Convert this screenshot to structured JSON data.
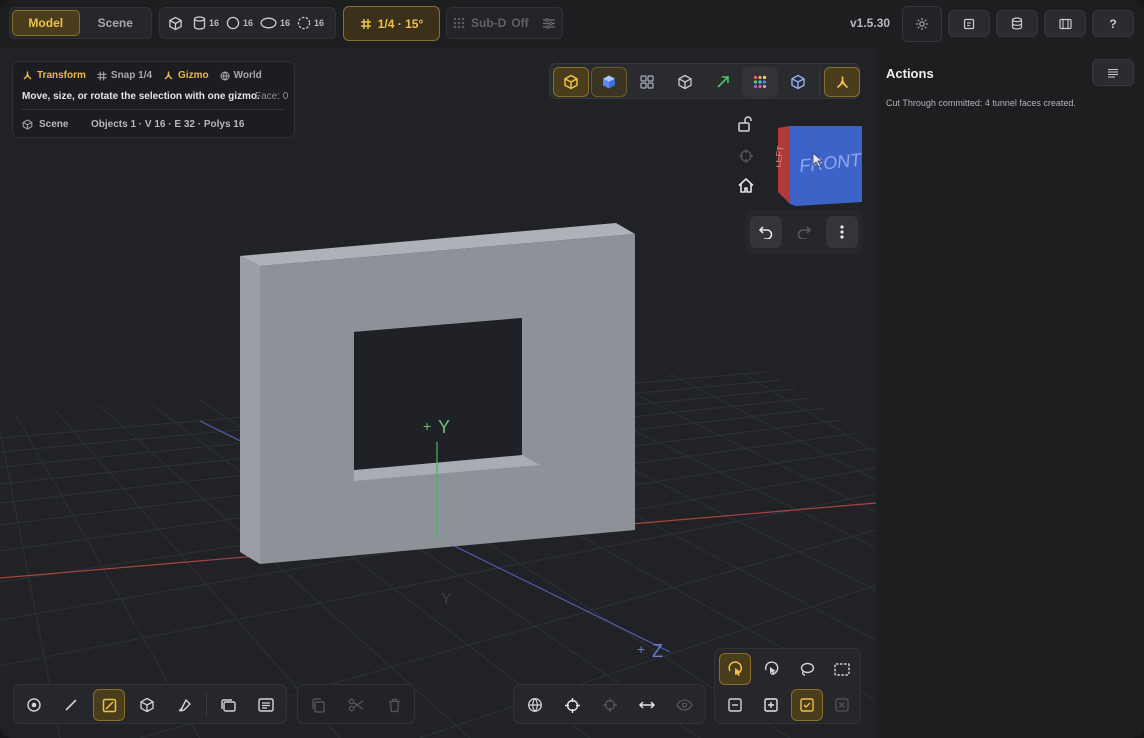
{
  "modes": {
    "model": "Model",
    "scene": "Scene"
  },
  "primitives": [
    {
      "icon": "cube-icon",
      "count": ""
    },
    {
      "icon": "cylinder-icon",
      "count": "16"
    },
    {
      "icon": "sphere-icon",
      "count": "16"
    },
    {
      "icon": "torus-icon",
      "count": "16"
    },
    {
      "icon": "ring-icon",
      "count": "16"
    }
  ],
  "snap": {
    "label": "1/4 · 15°"
  },
  "subd": {
    "label": "Sub-D",
    "state": "Off"
  },
  "version": "v1.5.30",
  "info": {
    "transform": "Transform",
    "snap": "Snap 1/4",
    "gizmo": "Gizmo",
    "space": "World",
    "description": "Move, size, or rotate the selection with one gizmo.",
    "face": "Face: 0",
    "scene": "Scene",
    "stats": "Objects 1 · V 16 · E 32 · Polys 16"
  },
  "axes": {
    "y": "Y",
    "neg_y": "Y",
    "z": "Z"
  },
  "navcube": {
    "front": "FRONT",
    "left": "LEFT"
  },
  "actions": {
    "title": "Actions",
    "log": "Cut Through committed: 4 tunnel faces created."
  },
  "colors": {
    "accent": "#e9b949",
    "accent_bg": "#4a3d1c",
    "x_axis": "#b54a43",
    "z_axis": "#4e62b8",
    "y_axis": "#4fb25c",
    "object": "#8d9198"
  }
}
